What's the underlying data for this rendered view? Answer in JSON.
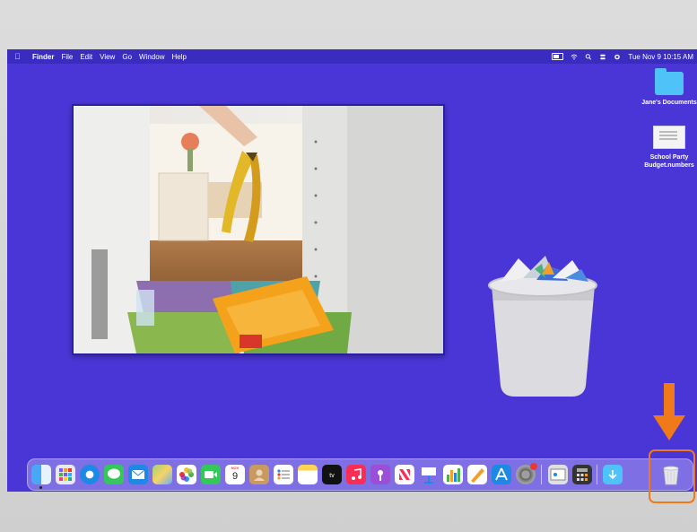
{
  "menubar": {
    "app_name": "Finder",
    "items": [
      "File",
      "Edit",
      "View",
      "Go",
      "Window",
      "Help"
    ],
    "clock": "Tue Nov 9  10:15 AM"
  },
  "desktop": {
    "icons": [
      {
        "label": "Jane's Documents",
        "icon": "folder-icon"
      },
      {
        "label": "School Party Budget.numbers",
        "icon": "numbers-file-icon"
      }
    ]
  },
  "photo": {
    "subject": "kitchen-recycling-bins"
  },
  "dock": {
    "calendar": {
      "month": "NOV",
      "day": "9"
    },
    "apps": [
      "finder",
      "launchpad",
      "safari",
      "messages",
      "mail",
      "maps",
      "photos",
      "facetime",
      "calendar",
      "contacts",
      "reminders",
      "notes",
      "tv",
      "music",
      "podcasts",
      "news",
      "keynote",
      "numbers",
      "pages",
      "app-store",
      "system-preferences",
      "preview",
      "calculator",
      "downloads-folder",
      "trash"
    ]
  },
  "colors": {
    "desktop": "#4a36d6",
    "menubar": "#3b2cc0",
    "arrow": "#f07a1a",
    "highlight": "#f07a1a"
  }
}
